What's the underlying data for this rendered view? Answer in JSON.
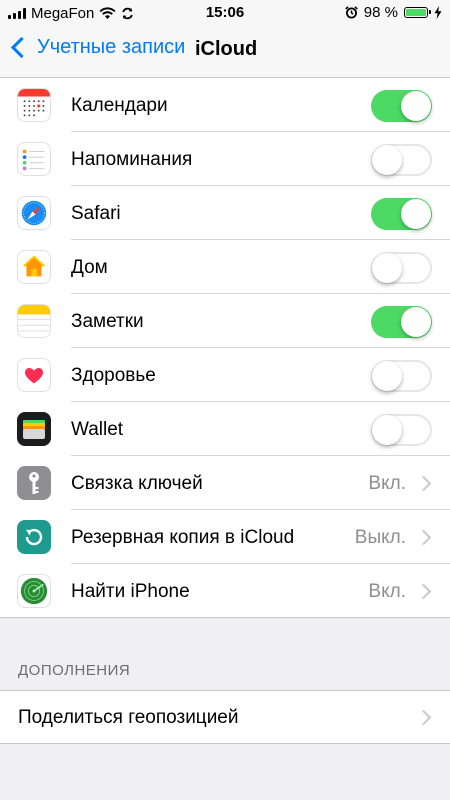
{
  "status_bar": {
    "carrier": "MegaFon",
    "time": "15:06",
    "battery": "98 %",
    "battery_level": 0.98
  },
  "nav": {
    "back_label": "Учетные записи",
    "title": "iCloud"
  },
  "rows": [
    {
      "label": "Календари",
      "icon": "calendar-icon",
      "control": "toggle",
      "on": true
    },
    {
      "label": "Напоминания",
      "icon": "reminders-icon",
      "control": "toggle",
      "on": false
    },
    {
      "label": "Safari",
      "icon": "safari-compass-icon",
      "control": "toggle",
      "on": true
    },
    {
      "label": "Дом",
      "icon": "home-icon",
      "control": "toggle",
      "on": false
    },
    {
      "label": "Заметки",
      "icon": "notes-icon",
      "control": "toggle",
      "on": true
    },
    {
      "label": "Здоровье",
      "icon": "health-heart-icon",
      "control": "toggle",
      "on": false
    },
    {
      "label": "Wallet",
      "icon": "wallet-icon",
      "control": "toggle",
      "on": false
    },
    {
      "label": "Связка ключей",
      "icon": "keychain-key-icon",
      "control": "disclosure",
      "value": "Вкл."
    },
    {
      "label": "Резервная копия в iCloud",
      "icon": "backup-icon",
      "control": "disclosure",
      "value": "Выкл."
    },
    {
      "label": "Найти iPhone",
      "icon": "find-iphone-radar-icon",
      "control": "disclosure",
      "value": "Вкл."
    }
  ],
  "addons": {
    "header": "ДОПОЛНЕНИЯ",
    "item_label": "Поделиться геопозицией"
  },
  "colors": {
    "accent": "#007aff",
    "toggle_on": "#4cd964",
    "secondary_text": "#8e8e93"
  }
}
